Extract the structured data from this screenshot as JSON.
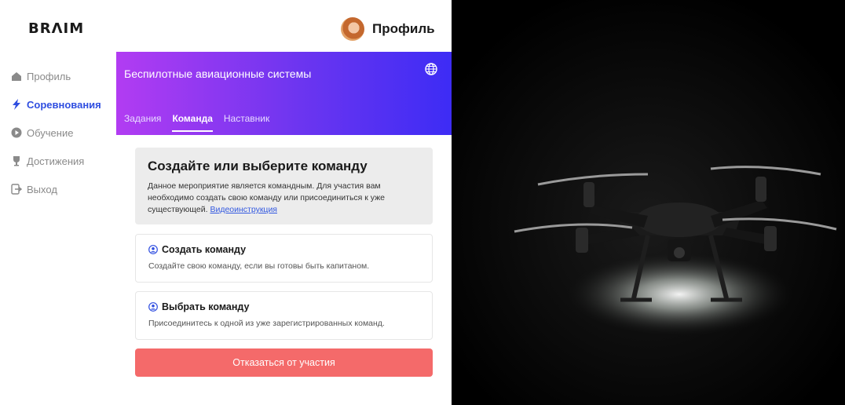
{
  "brand": {
    "logo": "BRΛIM"
  },
  "profile": {
    "label": "Профиль"
  },
  "sidebar": {
    "items": [
      {
        "label": "Профиль",
        "icon": "home-icon"
      },
      {
        "label": "Соревнования",
        "icon": "lightning-icon",
        "active": true
      },
      {
        "label": "Обучение",
        "icon": "play-icon"
      },
      {
        "label": "Достижения",
        "icon": "trophy-icon"
      },
      {
        "label": "Выход",
        "icon": "logout-icon"
      }
    ]
  },
  "header": {
    "title": "Беспилотные авиационные системы",
    "tabs": [
      {
        "label": "Задания"
      },
      {
        "label": "Команда",
        "active": true
      },
      {
        "label": "Наставник"
      }
    ]
  },
  "info": {
    "title": "Создайте или выберите команду",
    "text": "Данное мероприятие является командным. Для участия вам необходимо создать свою команду или присоединиться к уже существующей.",
    "link": "Видеоинструкция"
  },
  "cards": [
    {
      "title": "Создать команду",
      "desc": "Создайте свою команду, если вы готовы быть капитаном."
    },
    {
      "title": "Выбрать команду",
      "desc": "Присоединитесь к одной из уже зарегистрированных команд."
    }
  ],
  "actions": {
    "refuse": "Отказаться от участия"
  },
  "colors": {
    "accent": "#2f4ee0",
    "danger": "#f46a6a",
    "gradient_start": "#b23cf2",
    "gradient_end": "#3d2cf5"
  }
}
